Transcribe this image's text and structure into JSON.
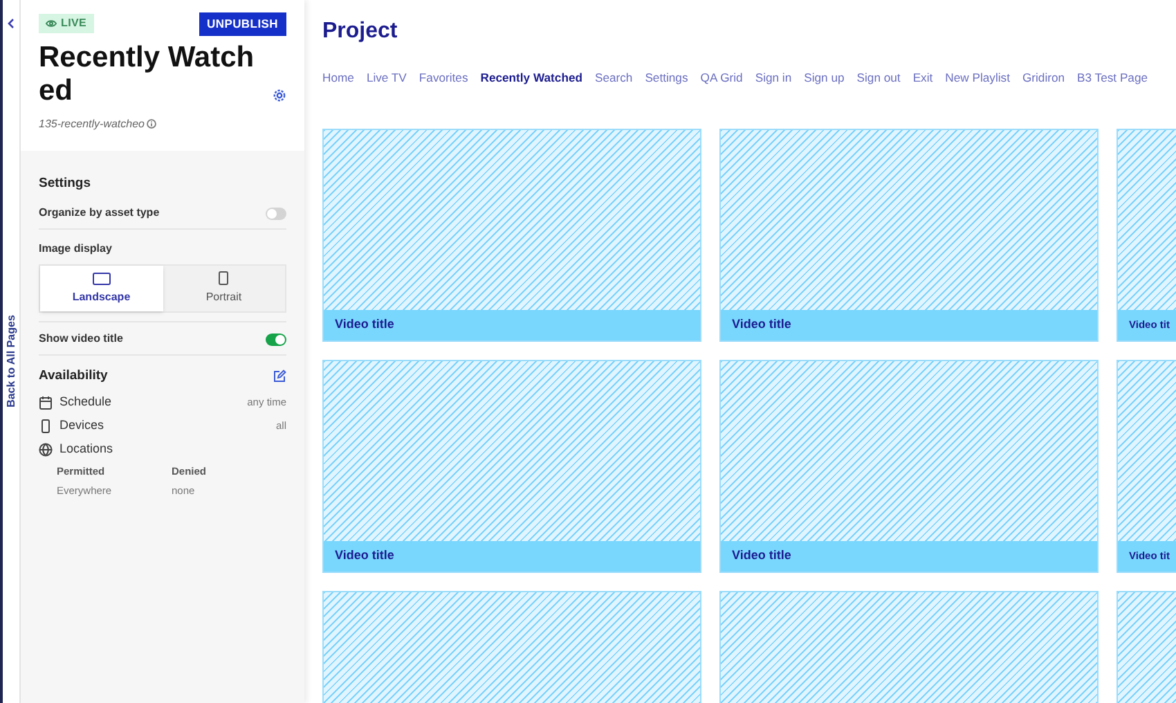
{
  "back_link": "Back to All Pages",
  "status_badge": {
    "label": "LIVE",
    "live": true
  },
  "unpublish_button": "UNPUBLISH",
  "page_title": "Recently Watched",
  "slug": "135-recently-watcheo",
  "settings": {
    "heading": "Settings",
    "organize": {
      "label": "Organize by asset type",
      "on": false
    },
    "image_display": {
      "label": "Image display",
      "options": [
        {
          "label": "Landscape",
          "kind": "landscape",
          "selected": true
        },
        {
          "label": "Portrait",
          "kind": "portrait",
          "selected": false
        }
      ]
    },
    "show_title": {
      "label": "Show video title",
      "on": true
    }
  },
  "availability": {
    "heading": "Availability",
    "rows": [
      {
        "kind": "schedule",
        "label": "Schedule",
        "value": "any time"
      },
      {
        "kind": "devices",
        "label": "Devices",
        "value": "all"
      },
      {
        "kind": "locations",
        "label": "Locations"
      }
    ],
    "permitted": {
      "label": "Permitted",
      "value": "Everywhere"
    },
    "denied": {
      "label": "Denied",
      "value": "none"
    }
  },
  "project_title": "Project",
  "nav": [
    {
      "label": "Home",
      "selected": false
    },
    {
      "label": "Live TV",
      "selected": false
    },
    {
      "label": "Favorites",
      "selected": false
    },
    {
      "label": "Recently Watched",
      "selected": true
    },
    {
      "label": "Search",
      "selected": false
    },
    {
      "label": "Settings",
      "selected": false
    },
    {
      "label": "QA Grid",
      "selected": false
    },
    {
      "label": "Sign in",
      "selected": false
    },
    {
      "label": "Sign up",
      "selected": false
    },
    {
      "label": "Sign out",
      "selected": false
    },
    {
      "label": "Exit",
      "selected": false
    },
    {
      "label": "New Playlist",
      "selected": false
    },
    {
      "label": "Gridiron",
      "selected": false
    },
    {
      "label": "B3 Test Page",
      "selected": false
    }
  ],
  "grid_rows": [
    [
      "Video title",
      "Video title",
      "Video tit"
    ],
    [
      "Video title",
      "Video title",
      "Video tit"
    ],
    [
      null,
      null,
      null
    ]
  ]
}
